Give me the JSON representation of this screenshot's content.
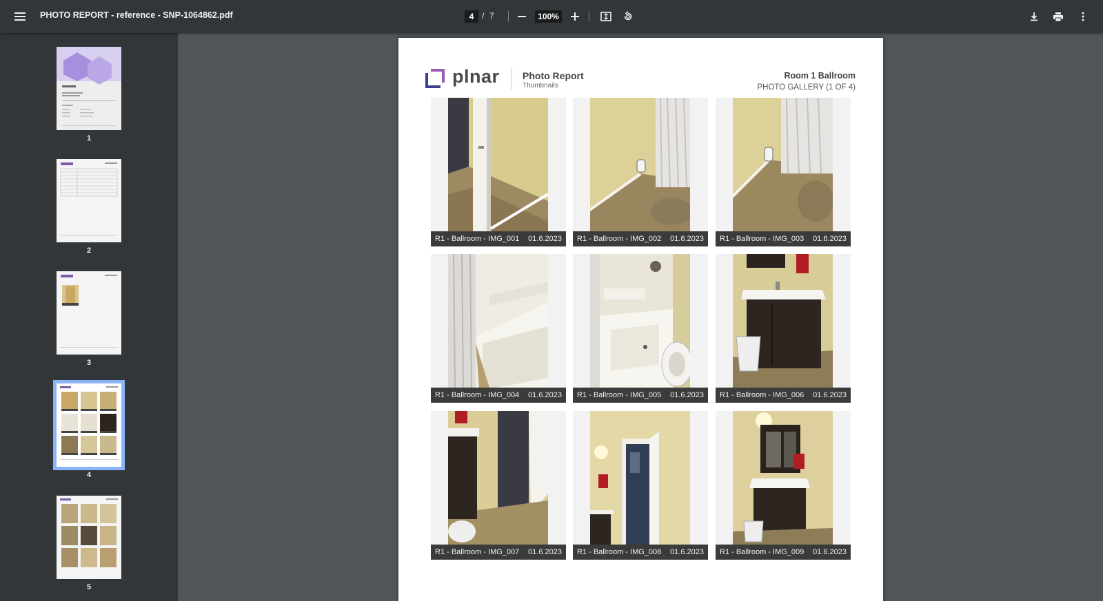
{
  "toolbar": {
    "title": "PHOTO REPORT - reference - SNP-1064862.pdf",
    "current_page": "4",
    "page_sep": "/",
    "total_pages": "7",
    "zoom": "100%",
    "icons": [
      "menu-icon",
      "zoom-out-icon",
      "zoom-in-icon",
      "fit-page-icon",
      "rotate-icon",
      "download-icon",
      "print-icon",
      "more-vert-icon"
    ]
  },
  "sidebar": {
    "thumbnails": [
      {
        "num": "1"
      },
      {
        "num": "2"
      },
      {
        "num": "3"
      },
      {
        "num": "4",
        "selected": true
      },
      {
        "num": "5"
      }
    ]
  },
  "page": {
    "logo_text": "plnar",
    "report_title": "Photo Report",
    "report_subtitle": "Thumbnails",
    "room_name": "Room 1 Ballroom",
    "gallery_label": "PHOTO GALLERY (1 OF 4)",
    "photos": [
      {
        "label": "R1 - Ballroom - IMG_001",
        "date": "01.6.2023"
      },
      {
        "label": "R1 - Ballroom - IMG_002",
        "date": "01.6.2023"
      },
      {
        "label": "R1 - Ballroom - IMG_003",
        "date": "01.6.2023"
      },
      {
        "label": "R1 - Ballroom - IMG_004",
        "date": "01.6.2023"
      },
      {
        "label": "R1 - Ballroom - IMG_005",
        "date": "01.6.2023"
      },
      {
        "label": "R1 - Ballroom - IMG_006",
        "date": "01.6.2023"
      },
      {
        "label": "R1 - Ballroom - IMG_007",
        "date": "01.6.2023"
      },
      {
        "label": "R1 - Ballroom - IMG_008",
        "date": "01.6.2023"
      },
      {
        "label": "R1 - Ballroom - IMG_009",
        "date": "01.6.2023"
      }
    ]
  },
  "colors": {
    "toolbar_bg": "#323639",
    "viewer_bg": "#525659",
    "selected_outline": "#8ab4f8",
    "logo_purple": "#7b5ea7",
    "caption_bg": "#3b3b3b"
  }
}
